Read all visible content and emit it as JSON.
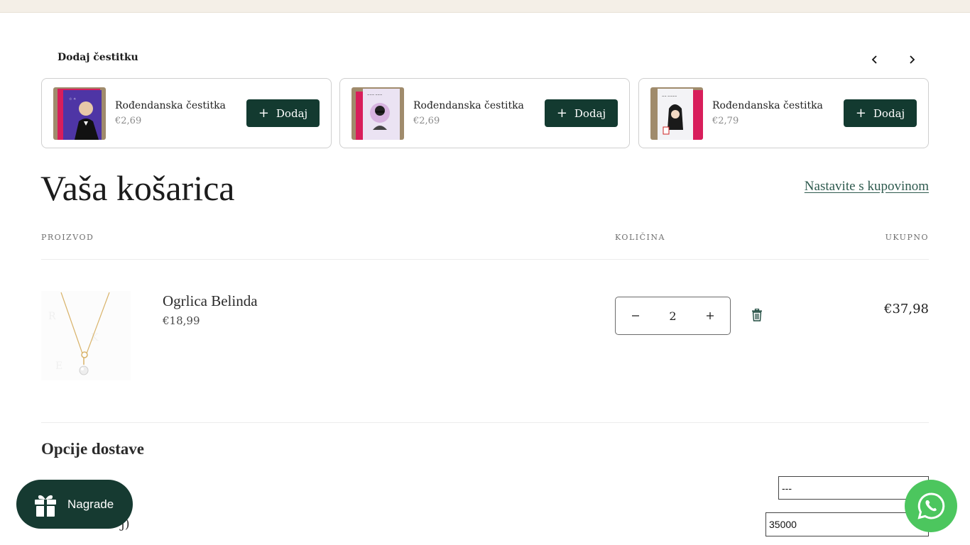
{
  "add_card_section": {
    "title": "Dodaj čestitku",
    "cards": [
      {
        "name": "Rođendanska čestitka",
        "price": "€2,69",
        "button_label": "Dodaj"
      },
      {
        "name": "Rođendanska čestitka",
        "price": "€2,69",
        "button_label": "Dodaj"
      },
      {
        "name": "Rođendanska čestitka",
        "price": "€2,79",
        "button_label": "Dodaj"
      }
    ]
  },
  "cart": {
    "title": "Vaša košarica",
    "continue_link": "Nastavite s kupovinom",
    "columns": {
      "product": "PROIZVOD",
      "quantity": "KOLIČINA",
      "total": "UKUPNO"
    },
    "items": [
      {
        "name": "Ogrlica Belinda",
        "price": "€18,99",
        "quantity": "2",
        "line_total": "€37,98"
      }
    ]
  },
  "shipping": {
    "title": "Opcije dostave",
    "select_value": "---",
    "postal_value": "35000",
    "partial_label": "j)"
  },
  "rewards_button": {
    "label": "Nagrade"
  },
  "icons": {
    "prev": "chevron-left-icon",
    "next": "chevron-right-icon",
    "trash": "trash-icon",
    "gift": "gift-icon",
    "whatsapp": "whatsapp-icon"
  },
  "colors": {
    "brand_dark": "#133a30",
    "link": "#2e5a4e",
    "whatsapp": "#4cc65e",
    "topbar": "#f4efe7"
  }
}
